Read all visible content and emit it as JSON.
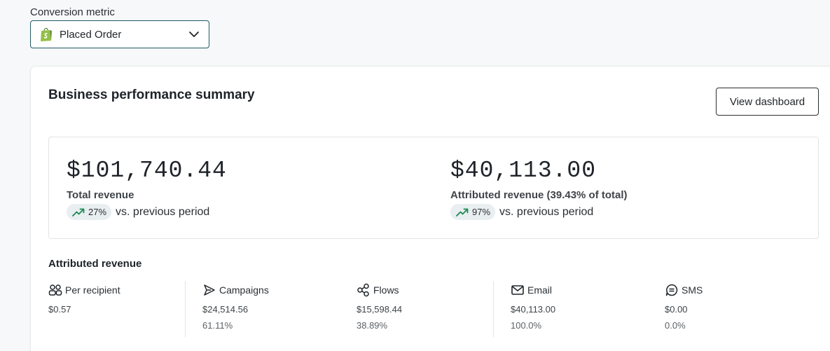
{
  "conversion_metric": {
    "label": "Conversion metric",
    "selected": "Placed Order",
    "icon": "shopify-bag-icon"
  },
  "summary": {
    "title": "Business performance summary",
    "view_button": "View dashboard",
    "total": {
      "value": "$101,740.44",
      "label": "Total revenue",
      "change": "27%",
      "change_text": "vs. previous period",
      "trend": "up"
    },
    "attributed": {
      "value": "$40,113.00",
      "label": "Attributed revenue (39.43% of total)",
      "change": "97%",
      "change_text": "vs. previous period",
      "trend": "up"
    }
  },
  "attributed_revenue": {
    "title": "Attributed revenue",
    "columns": [
      {
        "label": "Per recipient",
        "value": "$0.57",
        "percent": "",
        "icon": "people-icon"
      },
      {
        "label": "Campaigns",
        "value": "$24,514.56",
        "percent": "61.11%",
        "icon": "send-icon"
      },
      {
        "label": "Flows",
        "value": "$15,598.44",
        "percent": "38.89%",
        "icon": "flow-icon"
      },
      {
        "label": "Email",
        "value": "$40,113.00",
        "percent": "100.0%",
        "icon": "mail-icon"
      },
      {
        "label": "SMS",
        "value": "$0.00",
        "percent": "0.0%",
        "icon": "sms-icon"
      }
    ]
  },
  "colors": {
    "trend_up": "#1a8a52",
    "select_border": "#1f5b63",
    "shopify_green": "#95bf47"
  }
}
